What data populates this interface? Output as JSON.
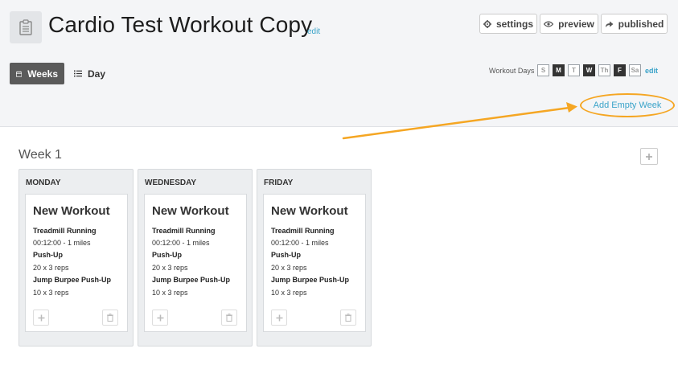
{
  "header": {
    "title": "Cardio Test Workout Copy",
    "title_edit": "edit",
    "buttons": {
      "settings": "settings",
      "preview": "preview",
      "published": "published"
    }
  },
  "view_toggle": {
    "weeks": "Weeks",
    "day": "Day"
  },
  "workout_days": {
    "label": "Workout Days",
    "days": [
      {
        "label": "S",
        "active": false
      },
      {
        "label": "M",
        "active": true
      },
      {
        "label": "T",
        "active": false
      },
      {
        "label": "W",
        "active": true
      },
      {
        "label": "Th",
        "active": false
      },
      {
        "label": "F",
        "active": true
      },
      {
        "label": "Sa",
        "active": false
      }
    ],
    "edit": "edit"
  },
  "add_empty_week": "Add Empty Week",
  "week": {
    "title": "Week 1",
    "days": [
      {
        "name": "MONDAY",
        "workout": {
          "title": "New Workout",
          "exercises": [
            {
              "name": "Treadmill Running",
              "detail": "00:12:00 - 1 miles"
            },
            {
              "name": "Push-Up",
              "detail": "20 x 3 reps"
            },
            {
              "name": "Jump Burpee Push-Up",
              "detail": "10 x 3 reps"
            }
          ]
        }
      },
      {
        "name": "WEDNESDAY",
        "workout": {
          "title": "New Workout",
          "exercises": [
            {
              "name": "Treadmill Running",
              "detail": "00:12:00 - 1 miles"
            },
            {
              "name": "Push-Up",
              "detail": "20 x 3 reps"
            },
            {
              "name": "Jump Burpee Push-Up",
              "detail": "10 x 3 reps"
            }
          ]
        }
      },
      {
        "name": "FRIDAY",
        "workout": {
          "title": "New Workout",
          "exercises": [
            {
              "name": "Treadmill Running",
              "detail": "00:12:00 - 1 miles"
            },
            {
              "name": "Push-Up",
              "detail": "20 x 3 reps"
            },
            {
              "name": "Jump Burpee Push-Up",
              "detail": "10 x 3 reps"
            }
          ]
        }
      }
    ]
  },
  "colors": {
    "accent": "#3aa3c9",
    "annotation": "#f5a623",
    "header_bg": "#f4f5f7",
    "active_toggle": "#5a5a5a"
  },
  "icons": {
    "plan": "clipboard-icon",
    "settings": "gear-icon",
    "preview": "eye-icon",
    "published": "share-arrow-icon",
    "weeks": "calendar-icon",
    "day": "list-icon",
    "add": "plus-icon",
    "delete": "trash-icon"
  }
}
